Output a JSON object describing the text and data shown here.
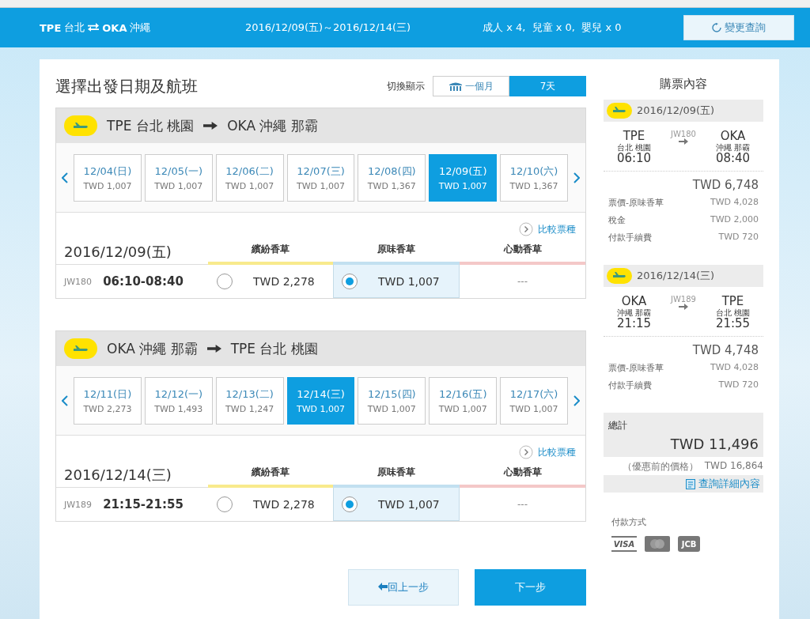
{
  "header": {
    "from_code": "TPE",
    "from_city": "台北",
    "to_code": "OKA",
    "to_city": "沖繩",
    "dates": "2016/12/09(五)～2016/12/14(三)",
    "passengers": "成人 x 4,  兒童 x 0,  嬰兒 x 0",
    "change_button": "變更查詢"
  },
  "page_title": "選擇出發日期及航班",
  "view_toggle": {
    "label": "切換顯示",
    "options": [
      {
        "label": "一個月",
        "selected": false
      },
      {
        "label": "7天",
        "selected": true
      }
    ]
  },
  "flights": [
    {
      "from_code": "TPE",
      "from_city": "台北 桃園",
      "to_code": "OKA",
      "to_city": "沖繩 那霸",
      "days": [
        {
          "date": "12/04(日)",
          "price": "TWD 1,007",
          "selected": false
        },
        {
          "date": "12/05(一)",
          "price": "TWD 1,007",
          "selected": false
        },
        {
          "date": "12/06(二)",
          "price": "TWD 1,007",
          "selected": false
        },
        {
          "date": "12/07(三)",
          "price": "TWD 1,007",
          "selected": false
        },
        {
          "date": "12/08(四)",
          "price": "TWD 1,367",
          "selected": false
        },
        {
          "date": "12/09(五)",
          "price": "TWD 1,007",
          "selected": true
        },
        {
          "date": "12/10(六)",
          "price": "TWD 1,367",
          "selected": false
        }
      ],
      "compare_link": "比較票種",
      "date": "2016/12/09(五)",
      "fare_types": [
        {
          "label": "繽紛香草",
          "color": "#f8ea8c"
        },
        {
          "label": "原味香草",
          "color": "#c2e0f0"
        },
        {
          "label": "心動香草",
          "color": "#f4c8c8"
        }
      ],
      "row": {
        "flight_no": "JW180",
        "time": "06:10-08:40",
        "fares": [
          {
            "kind": "price",
            "price": "TWD 2,278",
            "selected": false
          },
          {
            "kind": "price",
            "price": "TWD 1,007",
            "selected": true
          },
          {
            "kind": "none",
            "text": "---"
          }
        ]
      }
    },
    {
      "from_code": "OKA",
      "from_city": "沖繩 那霸",
      "to_code": "TPE",
      "to_city": "台北 桃園",
      "days": [
        {
          "date": "12/11(日)",
          "price": "TWD 2,273",
          "selected": false
        },
        {
          "date": "12/12(一)",
          "price": "TWD 1,493",
          "selected": false
        },
        {
          "date": "12/13(二)",
          "price": "TWD 1,247",
          "selected": false
        },
        {
          "date": "12/14(三)",
          "price": "TWD 1,007",
          "selected": true
        },
        {
          "date": "12/15(四)",
          "price": "TWD 1,007",
          "selected": false
        },
        {
          "date": "12/16(五)",
          "price": "TWD 1,007",
          "selected": false
        },
        {
          "date": "12/17(六)",
          "price": "TWD 1,007",
          "selected": false
        }
      ],
      "compare_link": "比較票種",
      "date": "2016/12/14(三)",
      "fare_types": [
        {
          "label": "繽紛香草",
          "color": "#f8ea8c"
        },
        {
          "label": "原味香草",
          "color": "#c2e0f0"
        },
        {
          "label": "心動香草",
          "color": "#f4c8c8"
        }
      ],
      "row": {
        "flight_no": "JW189",
        "time": "21:15-21:55",
        "fares": [
          {
            "kind": "price",
            "price": "TWD 2,278",
            "selected": false
          },
          {
            "kind": "price",
            "price": "TWD 1,007",
            "selected": true
          },
          {
            "kind": "none",
            "text": "---"
          }
        ]
      }
    }
  ],
  "summary": {
    "title": "購票內容",
    "legs": [
      {
        "date": "2016/12/09(五)",
        "from_code": "TPE",
        "from_city": "台北 桃園",
        "dep": "06:10",
        "flight_no": "JW180",
        "to_code": "OKA",
        "to_city": "沖繩 那霸",
        "arr": "08:40",
        "subtotal": "TWD 6,748",
        "lines": [
          {
            "label": "票價-原味香草",
            "value": "TWD 4,028"
          },
          {
            "label": "稅金",
            "value": "TWD 2,000"
          },
          {
            "label": "付款手續費",
            "value": "TWD 720"
          }
        ]
      },
      {
        "date": "2016/12/14(三)",
        "from_code": "OKA",
        "from_city": "沖繩 那霸",
        "dep": "21:15",
        "flight_no": "JW189",
        "to_code": "TPE",
        "to_city": "台北 桃園",
        "arr": "21:55",
        "subtotal": "TWD 4,748",
        "lines": [
          {
            "label": "票價-原味香草",
            "value": "TWD 4,028"
          },
          {
            "label": "付款手續費",
            "value": "TWD 720"
          }
        ]
      }
    ],
    "total": {
      "label": "總計",
      "amount": "TWD 11,496",
      "original_label": "（優惠前的價格）",
      "original": "TWD 16,864",
      "details_link": "查詢詳細內容"
    },
    "payment": {
      "label": "付款方式",
      "cards": [
        {
          "kind": "visa",
          "label": "VISA"
        },
        {
          "kind": "mastercard"
        },
        {
          "kind": "jcb",
          "label": "JCB"
        }
      ]
    }
  },
  "buttons": {
    "back": "回上一步",
    "next": "下一步"
  }
}
